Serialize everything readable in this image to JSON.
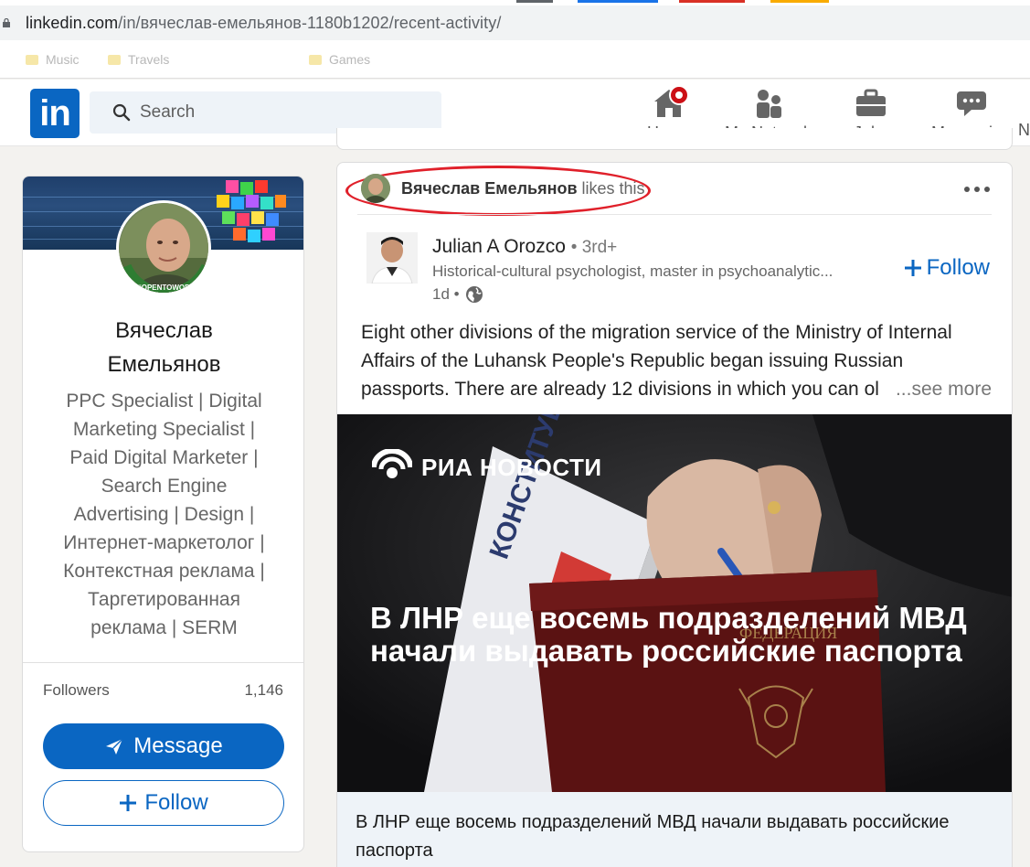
{
  "browser": {
    "url_host": "linkedin.com",
    "url_path": "/in/вячеслав-емельянов-1180b1202/recent-activity/",
    "bookmarks": [
      {
        "label": "Music"
      },
      {
        "label": "Travels"
      },
      {
        "label": "Games"
      }
    ]
  },
  "nav": {
    "logo": "in",
    "search_placeholder": "Search",
    "items": [
      {
        "label": "Home"
      },
      {
        "label": "My Network"
      },
      {
        "label": "Jobs"
      },
      {
        "label": "Messaging"
      }
    ],
    "cut_label": "N"
  },
  "profile": {
    "name_line1": "Вячеслав",
    "name_line2": "Емельянов",
    "opentowork_badge": "#OPENTOWORK",
    "headline_lines": [
      "PPC Specialist | Digital",
      "Marketing Specialist |",
      "Paid Digital Marketer |",
      "Search Engine",
      "Advertising | Design |",
      "Интернет-маркетолог |",
      "Контекстная реклама |",
      "Таргетированная",
      "реклама | SERM"
    ],
    "followers_label": "Followers",
    "followers_count": "1,146",
    "message_button": "Message",
    "follow_button": "Follow"
  },
  "post": {
    "liker_name": "Вячеслав Емельянов",
    "liker_action": "likes this",
    "author_name": "Julian A Orozco",
    "author_degree": "• 3rd+",
    "author_headline": "Historical-cultural psychologist, master in psychoanalytic...",
    "author_time": "1d •",
    "follow_label": "Follow",
    "text_line1": "Eight other divisions of the migration service of the Ministry of Internal",
    "text_line2": "Affairs of the Luhansk People's Republic began issuing Russian",
    "text_line3": "passports. There are already 12 divisions in which you can ol",
    "see_more": "...see more",
    "image_brand": "РИА НОВОСТИ",
    "image_overlay_title": "В ЛНР еще восемь подразделений МВД начали выдавать российские паспорта",
    "link_caption": "В ЛНР еще восемь подразделений МВД начали выдавать российские паспорта",
    "book_text": "КОНСТИТУЦИЯ",
    "passport_text": "ФЕДЕРАЦИЯ"
  },
  "colors": {
    "linkedin_blue": "#0a66c2",
    "highlight_red": "#e0202a",
    "notification_red": "#cc1016"
  }
}
